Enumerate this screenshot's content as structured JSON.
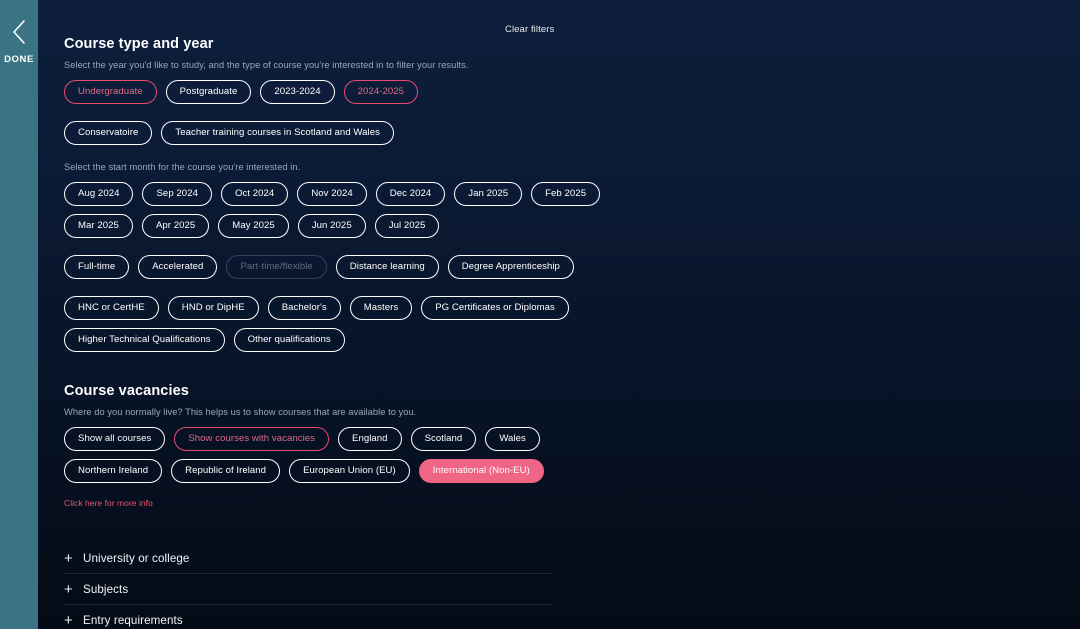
{
  "rail": {
    "icon": "chevron-left-icon",
    "label": "DONE"
  },
  "header": {
    "clear_filters_label": "Clear filters"
  },
  "colors": {
    "accent_pink": "#ef6585",
    "accent_pink_border": "#e84a70",
    "rail_teal": "#3a7383",
    "background_top": "#0d1f3d",
    "background_bottom": "#040b16",
    "help_text": "#9aa7bb",
    "link_pink": "#e8526f",
    "disabled_border": "#34425c",
    "disabled_text": "#5d6b82"
  },
  "sections": [
    {
      "title": "Course type and year",
      "help": "Select the year you'd like to study, and the type of course you're interested in to filter your results.",
      "help2": "Select the start month for the course you're interested in.",
      "rows": [
        [
          {
            "label": "Undergraduate",
            "state": "outlined-pink"
          },
          {
            "label": "Postgraduate",
            "state": "default"
          },
          {
            "label": "2023-2024",
            "state": "default"
          },
          {
            "label": "2024-2025",
            "state": "outlined-pink"
          }
        ],
        [
          {
            "label": "Conservatoire",
            "state": "default"
          },
          {
            "label": "Teacher training courses in Scotland and Wales",
            "state": "default"
          }
        ],
        [
          {
            "label": "Aug 2024",
            "state": "default"
          },
          {
            "label": "Sep 2024",
            "state": "default"
          },
          {
            "label": "Oct 2024",
            "state": "default"
          },
          {
            "label": "Nov 2024",
            "state": "default"
          },
          {
            "label": "Dec 2024",
            "state": "default"
          },
          {
            "label": "Jan 2025",
            "state": "default"
          },
          {
            "label": "Feb 2025",
            "state": "default"
          }
        ],
        [
          {
            "label": "Mar 2025",
            "state": "default"
          },
          {
            "label": "Apr 2025",
            "state": "default"
          },
          {
            "label": "May 2025",
            "state": "default"
          },
          {
            "label": "Jun 2025",
            "state": "default"
          },
          {
            "label": "Jul 2025",
            "state": "default"
          }
        ],
        [
          {
            "label": "Full-time",
            "state": "default"
          },
          {
            "label": "Accelerated",
            "state": "default"
          },
          {
            "label": "Part-time/flexible",
            "state": "disabled"
          },
          {
            "label": "Distance learning",
            "state": "default"
          },
          {
            "label": "Degree Apprenticeship",
            "state": "default"
          }
        ],
        [
          {
            "label": "HNC or CertHE",
            "state": "default"
          },
          {
            "label": "HND or DipHE",
            "state": "default"
          },
          {
            "label": "Bachelor's",
            "state": "default"
          },
          {
            "label": "Masters",
            "state": "default"
          },
          {
            "label": "PG Certificates or Diplomas",
            "state": "default"
          }
        ],
        [
          {
            "label": "Higher Technical Qualifications",
            "state": "default"
          },
          {
            "label": "Other qualifications",
            "state": "default"
          }
        ]
      ]
    },
    {
      "title": "Course vacancies",
      "help": "Where do you normally live? This helps us to show courses that are available to you.",
      "more_info_label": "Click here for more info",
      "rows": [
        [
          {
            "label": "Show all courses",
            "state": "default"
          },
          {
            "label": "Show courses with vacancies",
            "state": "outlined-pink"
          },
          {
            "label": "England",
            "state": "default"
          },
          {
            "label": "Scotland",
            "state": "default"
          },
          {
            "label": "Wales",
            "state": "default"
          }
        ],
        [
          {
            "label": "Northern Ireland",
            "state": "default"
          },
          {
            "label": "Republic of Ireland",
            "state": "default"
          },
          {
            "label": "European Union (EU)",
            "state": "default"
          },
          {
            "label": "International (Non-EU)",
            "state": "filled-pink"
          }
        ]
      ]
    }
  ],
  "accordion": {
    "items": [
      {
        "label": "University or college",
        "icon": "plus-icon",
        "expanded": false
      },
      {
        "label": "Subjects",
        "icon": "plus-icon",
        "expanded": false
      },
      {
        "label": "Entry requirements",
        "icon": "plus-icon",
        "expanded": false
      }
    ]
  }
}
